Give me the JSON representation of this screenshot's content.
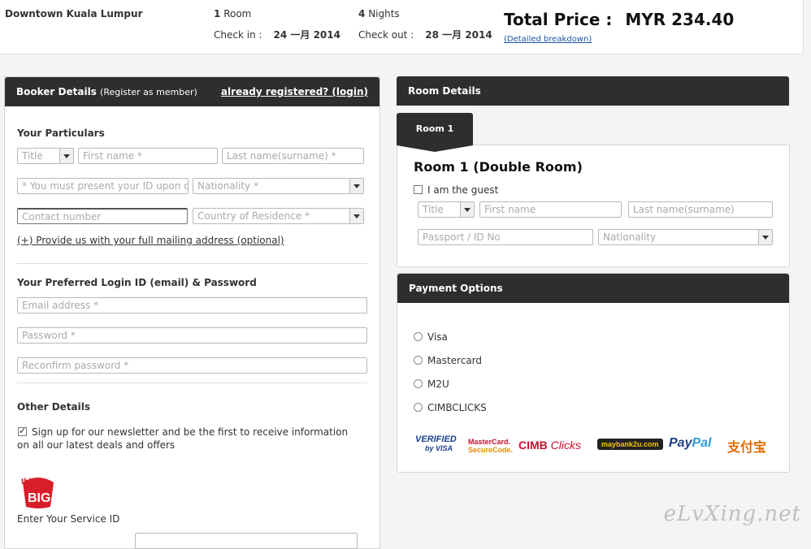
{
  "summary": {
    "hotel": "Downtown Kuala Lumpur",
    "rooms_count": "1",
    "rooms_label": "Room",
    "nights_count": "4",
    "nights_label": "Nights",
    "checkin_label": "Check in :",
    "checkin_value": "24 一月 2014",
    "checkout_label": "Check out :",
    "checkout_value": "28 一月 2014",
    "total_label": "Total Price :",
    "total_value": "MYR 234.40",
    "breakdown_link": "(Detailed breakdown)"
  },
  "booker": {
    "header_title": "Booker Details",
    "header_sub": "(Register as member)",
    "login_link": "already registered? (login)",
    "particulars_title": "Your Particulars",
    "title_placeholder": "Title",
    "first_name_placeholder": "First name *",
    "last_name_placeholder": "Last name(surname) *",
    "id_placeholder": "* You must present your ID upon ch",
    "nationality_placeholder": "Nationality *",
    "contact_placeholder": "Contact number",
    "country_placeholder": "Country of Residence *",
    "mailing_link": "(+) Provide us with your full mailing address (optional)",
    "login_title": "Your Preferred Login ID (email) & Password",
    "email_placeholder": "Email address *",
    "password_placeholder": "Password *",
    "reconfirm_placeholder": "Reconfirm password *",
    "other_title": "Other Details",
    "newsletter_text": "Sign up for our newsletter and be the first to receive information on all our latest deals and offers",
    "thinkbig_top": "think",
    "thinkbig_bottom": "BIG",
    "service_id_label": "Enter Your Service ID"
  },
  "room": {
    "header_title": "Room Details",
    "tab_label": "Room 1",
    "title": "Room 1 (Double Room)",
    "guest_checkbox_label": "I am the guest",
    "title_placeholder": "Title",
    "first_name_placeholder": "First name",
    "last_name_placeholder": "Last name(surname)",
    "passport_placeholder": "Passport / ID No",
    "nationality_placeholder": "Nationality"
  },
  "payment": {
    "header_title": "Payment Options",
    "options": [
      "Visa",
      "Mastercard",
      "M2U",
      "CIMBCLICKS"
    ],
    "logos": {
      "verified_visa_top": "VERIFIED",
      "verified_visa_bottom": "by VISA",
      "mastercard_top": "MasterCard.",
      "mastercard_bottom": "SecureCode.",
      "cimb": "CIMB",
      "cimb_clicks": "Clicks",
      "maybank": "maybank2u.com",
      "paypal_a": "Pay",
      "paypal_b": "Pal",
      "alipay": "支付宝"
    }
  },
  "watermark": "eLvXing.net",
  "colors": {
    "header_dark": "#2e2e2e",
    "link_blue": "#1a55a8",
    "paypal_blue": "#1b3f8f",
    "paypal_light": "#2a9fd8",
    "cimb_red": "#c8102e"
  }
}
